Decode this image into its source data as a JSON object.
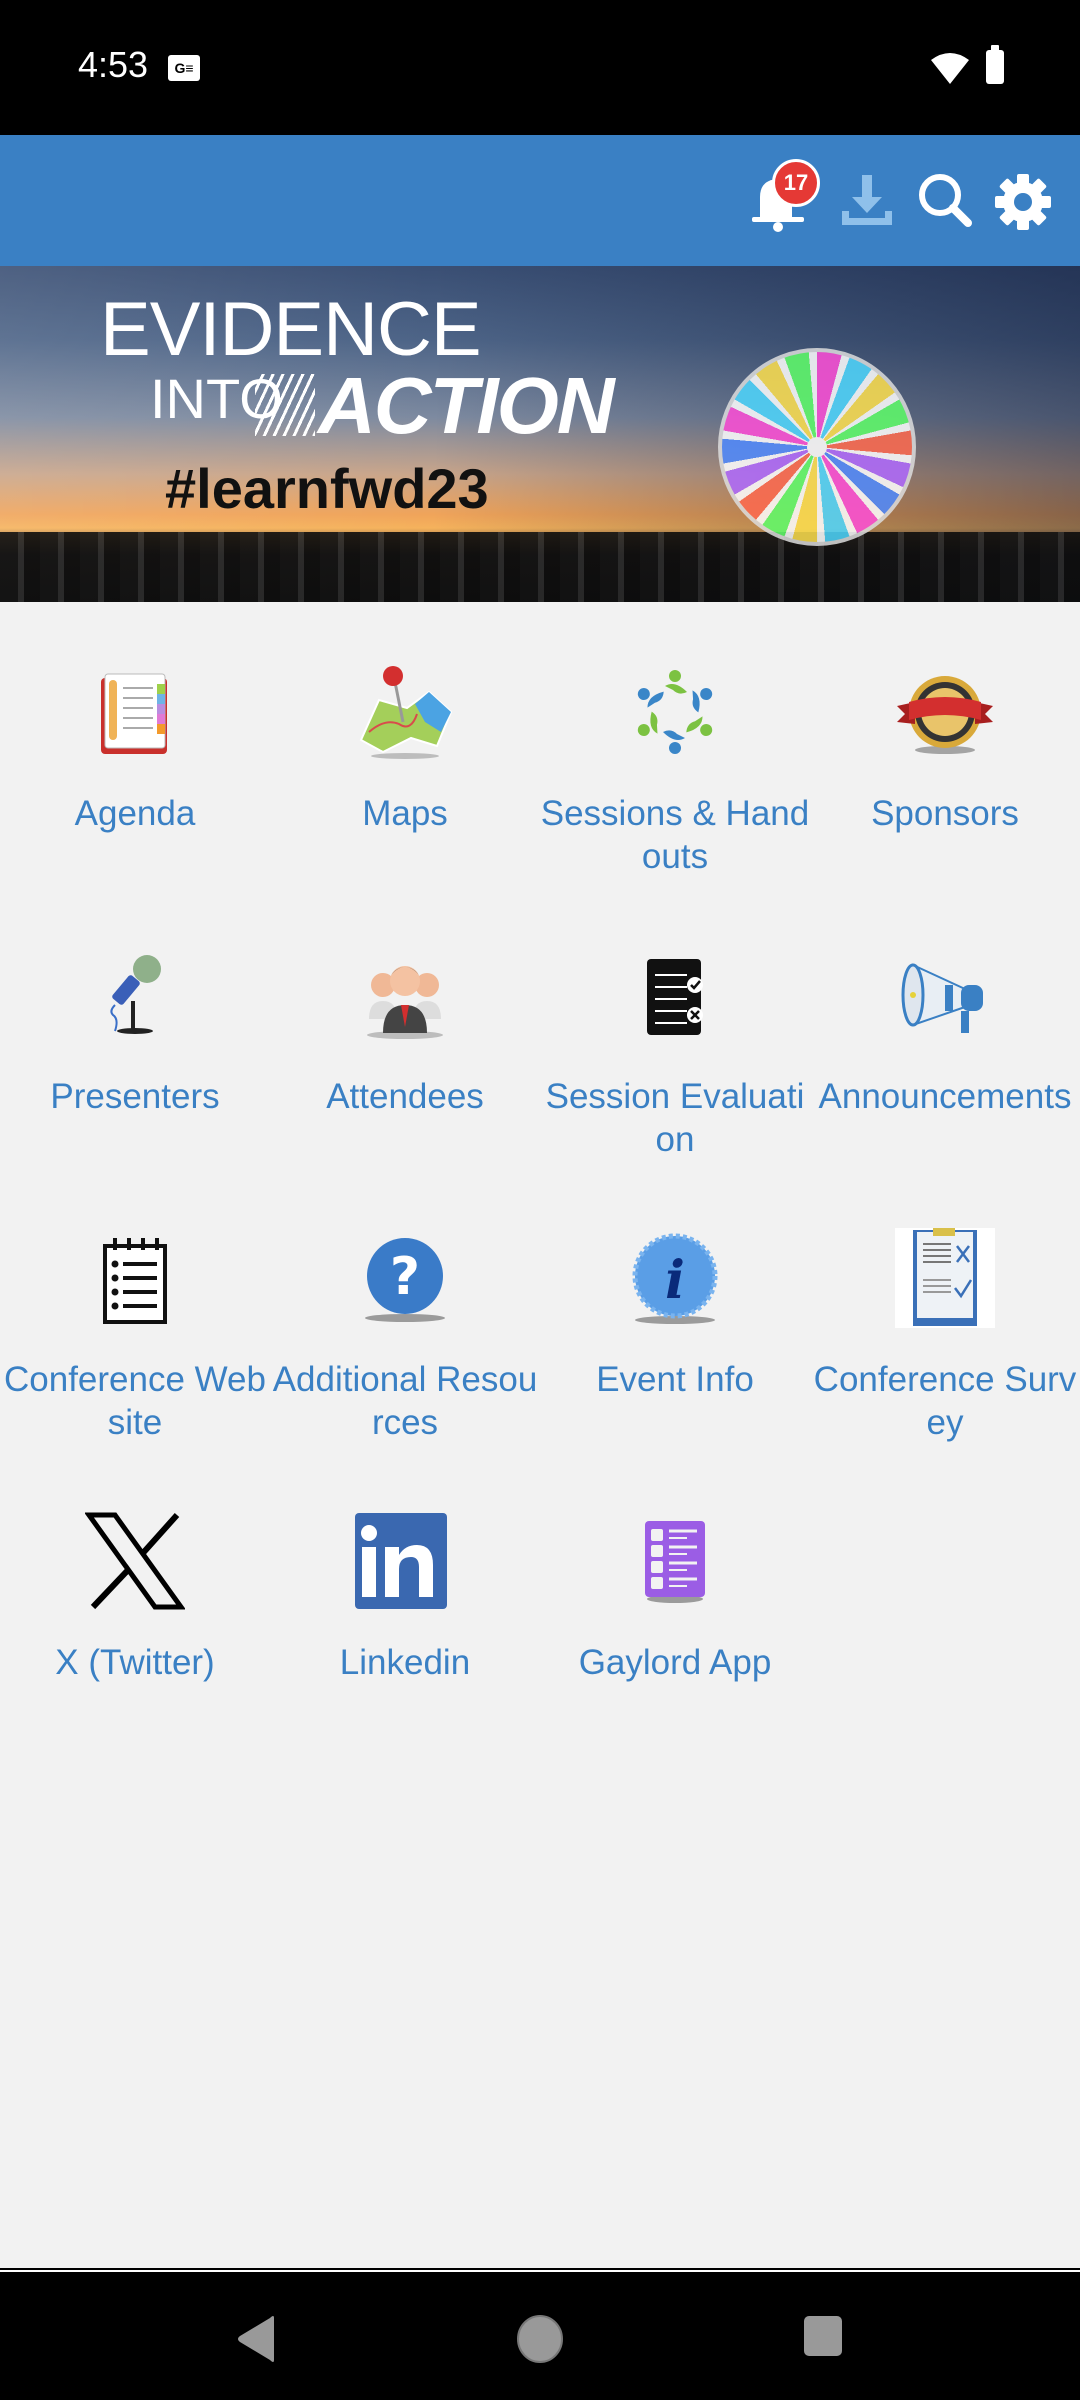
{
  "status_bar": {
    "time": "4:53",
    "sim_label": "G☰",
    "icons": [
      "wifi-icon",
      "battery-icon"
    ]
  },
  "header": {
    "notification_count": "17",
    "actions": [
      "bell-icon",
      "download-icon",
      "search-icon",
      "gear-icon"
    ],
    "bg_color": "#3a80c4",
    "badge_color": "#e53935"
  },
  "banner": {
    "line1": "EVIDENCE",
    "line2_small": "INTO",
    "line2_bold": "ACTION",
    "hashtag": "#learnfwd23"
  },
  "menu": {
    "label_color": "#3a80c4",
    "items": [
      {
        "label": "Agenda",
        "icon": "agenda-book-icon"
      },
      {
        "label": "Maps",
        "icon": "map-pin-icon"
      },
      {
        "label": "Sessions & Handouts",
        "icon": "people-circle-icon"
      },
      {
        "label": "Sponsors",
        "icon": "ribbon-seal-icon"
      },
      {
        "label": "Presenters",
        "icon": "microphone-icon"
      },
      {
        "label": "Attendees",
        "icon": "group-people-icon"
      },
      {
        "label": "Session Evaluation",
        "icon": "evaluation-checklist-icon"
      },
      {
        "label": "Announcements",
        "icon": "megaphone-icon"
      },
      {
        "label": "Conference Website",
        "icon": "notepad-list-icon"
      },
      {
        "label": "Additional Resources",
        "icon": "question-mark-icon"
      },
      {
        "label": "Event Info",
        "icon": "info-badge-icon"
      },
      {
        "label": "Conference Survey",
        "icon": "clipboard-survey-icon"
      },
      {
        "label": "X (Twitter)",
        "icon": "x-logo-icon"
      },
      {
        "label": "Linkedin",
        "icon": "linkedin-logo-icon"
      },
      {
        "label": "Gaylord App",
        "icon": "purple-list-icon"
      }
    ]
  },
  "nav_bar": {
    "buttons": [
      "back-icon",
      "home-icon",
      "recents-icon"
    ]
  }
}
